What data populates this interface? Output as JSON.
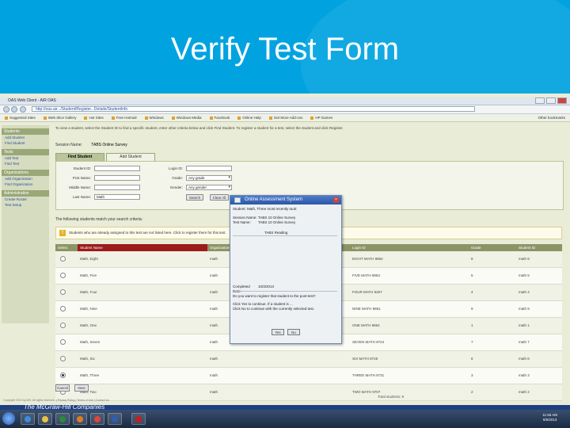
{
  "slide": {
    "title": "Verify Test Form"
  },
  "window": {
    "tab_label": "OAS Web Client - AIR OAS"
  },
  "browser": {
    "url": "http://oas.air.../Student/Register...Details/StudentInfo"
  },
  "bookmarks": [
    "Suggested Sites",
    "Web Slice Gallery",
    "Hot Sites",
    "Free Hotmail",
    "Windows",
    "Windows Media",
    "Facebook",
    "Online Help",
    "Get More Add-ons",
    "HP Games"
  ],
  "bookmark_right": "Other bookmarks",
  "nav": {
    "sections": [
      {
        "header": "Students",
        "items": [
          "Add Student",
          "Find Student"
        ]
      },
      {
        "header": "Tests",
        "items": [
          "Add Test",
          "Find Test"
        ]
      },
      {
        "header": "Organizations",
        "items": [
          "Add Organization",
          "Find Organization"
        ]
      },
      {
        "header": "Administration",
        "items": [
          "Create Roster",
          "Test Setup"
        ]
      }
    ]
  },
  "intro_text": "To view a student, select the Student ID to find a specific student, enter other criteria below and click Find Student. To register a student for a test, select the student and click Register.",
  "session": {
    "label": "Session Name:",
    "value": "TABS Online Survey"
  },
  "tabs": {
    "find": "Find Student",
    "add": "Add Student"
  },
  "form": {
    "student_id_label": "Student ID:",
    "first_name_label": "First Name:",
    "middle_name_label": "Middle Name:",
    "last_name_label": "Last Name:",
    "last_name_value": "Math",
    "login_id_label": "Login ID:",
    "grade_label": "Grade:",
    "grade_value": "Any grade",
    "gender_label": "Gender:",
    "gender_value": "Any gender",
    "search_button": "Search",
    "clear_button": "Clear All"
  },
  "result_message": "The following students match your search criteria:",
  "notice_text": "Students who are already assigned to this test are not listed here. Click to register them for this test.",
  "table": {
    "headers": [
      "Select",
      "Student Name",
      "Organization",
      "Login ID",
      "Grade",
      "Student ID"
    ],
    "rows": [
      {
        "name": "Math, Eight",
        "org": "math",
        "login": "EIGHT MATH 9862",
        "grade": "8",
        "id": "math 8"
      },
      {
        "name": "Math, Five",
        "org": "math",
        "login": "FIVE MATH 9863",
        "grade": "5",
        "id": "math 5"
      },
      {
        "name": "Math, Four",
        "org": "math",
        "login": "FOUR MATH 9267",
        "grade": "4",
        "id": "math 4"
      },
      {
        "name": "Math, Nine",
        "org": "math",
        "login": "NINE MATH 9861",
        "grade": "9",
        "id": "math 9"
      },
      {
        "name": "Math, One",
        "org": "math",
        "login": "ONE MATH 9864",
        "grade": "1",
        "id": "math 1"
      },
      {
        "name": "Math, Seven",
        "org": "math",
        "login": "SEVEN MATH 9724",
        "grade": "7",
        "id": "math 7"
      },
      {
        "name": "Math, Six",
        "org": "math",
        "login": "SIX MATH 9725",
        "grade": "6",
        "id": "math 6"
      },
      {
        "name": "Math, Three",
        "org": "math",
        "login": "THREE MATH 9731",
        "grade": "3",
        "id": "math 3"
      },
      {
        "name": "Math, Two",
        "org": "math",
        "login": "TWO MATH 9707",
        "grade": "2",
        "id": "math 2"
      }
    ],
    "selected_row": 7,
    "footer": "Total students: 9"
  },
  "bottom_buttons": {
    "cancel": "Cancel",
    "next": "Next"
  },
  "footer_text": "Copyright 2013 by AIR. All rights reserved. | Privacy Policy | Terms of Use | Contact Us",
  "modal": {
    "title": "Online Assessment System",
    "student_label": "Student: Math, Three",
    "student_suffix": "most recently took:",
    "session_label": "Session Name:",
    "session_value": "TABS 10 Online Survey",
    "test_label": "Test Name:",
    "test_value": "TABS 10 Online Survey",
    "mid_text": "TABS Reading",
    "completed_label": "Completed Date:",
    "completed_value": "10/3/2013",
    "question": "Do you want to register that student to the post-test?",
    "hint1": "Click Yes to continue. If a student is ...",
    "hint2": "Click No to continue with the currently selected test.",
    "yes": "Yes",
    "no": "No"
  },
  "company": "The McGraw-Hill Companies",
  "clock": {
    "time": "11:55 AM",
    "date": "9/5/2013"
  }
}
